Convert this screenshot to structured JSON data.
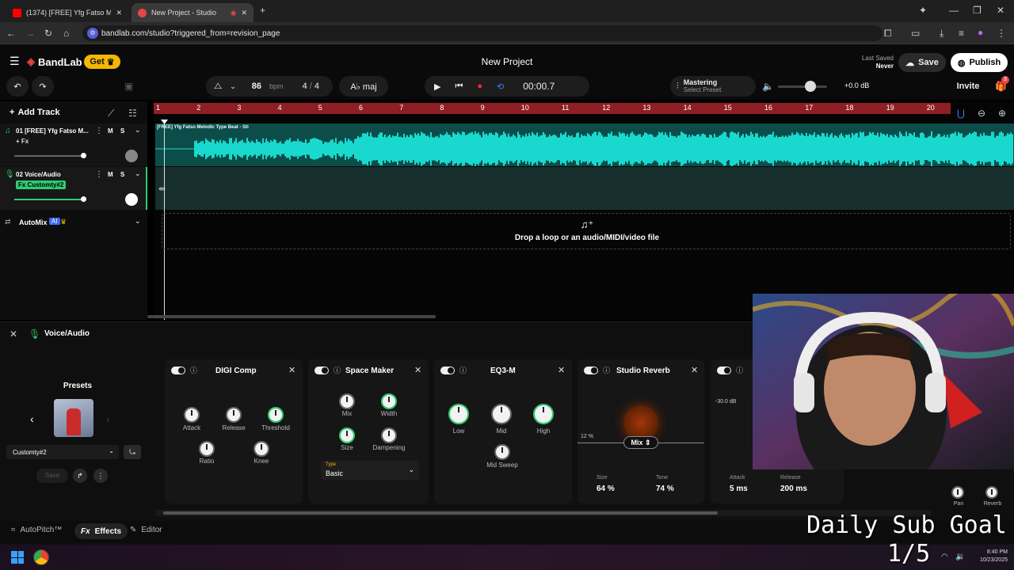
{
  "browser": {
    "tabs": [
      {
        "label": "(1374) [FREE] Yfg Fatso Melodic",
        "favicon_color": "#ff0000"
      },
      {
        "label": "New Project - Studio",
        "favicon_color": "#e84545"
      }
    ],
    "url": "bandlab.com/studio?triggered_from=revision_page"
  },
  "header": {
    "brand": "BandLab",
    "get_label": "Get",
    "project_title": "New Project",
    "last_saved_label": "Last Saved",
    "last_saved_value": "Never",
    "save_label": "Save",
    "publish_label": "Publish",
    "invite_label": "Invite",
    "gift_badge": "3"
  },
  "transport": {
    "bpm": "86",
    "bpm_unit": "bpm",
    "time_sig_num": "4",
    "time_sig_sep": "/",
    "time_sig_den": "4",
    "key": "A♭ maj",
    "time": "00:00.7",
    "mastering_label": "Mastering",
    "mastering_preset": "Select Preset",
    "volume_db": "+0.0 dB"
  },
  "tracks_panel": {
    "add_track_label": "Add Track",
    "tracks": [
      {
        "name": "01  [FREE] Yfg Fatso M...",
        "tag": "+ Fx",
        "mute": "M",
        "solo": "S"
      },
      {
        "name": "02  Voice/Audio",
        "tag": "Fx  Customty#2",
        "mute": "M",
        "solo": "S"
      }
    ],
    "automix_label": "AutoMix",
    "ai_badge": "AI"
  },
  "timeline": {
    "ruler": [
      "1",
      "2",
      "3",
      "4",
      "5",
      "6",
      "7",
      "8",
      "9",
      "10",
      "11",
      "12",
      "13",
      "14",
      "15",
      "16",
      "17",
      "18",
      "19",
      "20"
    ],
    "clip_label": "[FREE] Yfg Fatso Melodic Type Beat - Sti",
    "drop_text": "Drop a loop or an audio/MIDI/video file"
  },
  "fx": {
    "track_label": "Voice/Audio",
    "presets_title": "Presets",
    "preset_name": "Customty#2",
    "save_label": "Save",
    "digi_comp": {
      "title": "DIGI Comp",
      "knobs": [
        "Attack",
        "Release",
        "Threshold",
        "Ratio",
        "Knee"
      ]
    },
    "space_maker": {
      "title": "Space Maker",
      "knobs": [
        "Mix",
        "Width",
        "Size",
        "Dampening"
      ],
      "type_label": "Type",
      "type_value": "Basic"
    },
    "eq": {
      "title": "EQ3-M",
      "knobs": [
        "Low",
        "Mid",
        "High",
        "Mid Sweep"
      ]
    },
    "reverb": {
      "title": "Studio Reverb",
      "left_pct": "12 %",
      "mix_label": "Mix",
      "size_label": "Size",
      "size_value": "64 %",
      "tone_label": "Tone",
      "tone_value": "74 %"
    },
    "fifth": {
      "db": "-30.0 dB",
      "attack_label": "Attack",
      "attack_value": "5 ms",
      "release_label": "Release",
      "release_value": "200 ms"
    },
    "pan_label": "Pan",
    "reverb_label": "Reverb"
  },
  "bottom_tabs": {
    "autopitch": "AutoPitch™",
    "effects": "Effects",
    "editor": "Editor"
  },
  "overlay": {
    "goal_line1": "Daily Sub Goal",
    "goal_line2": "1/5"
  },
  "taskbar": {
    "time": "8:40 PM",
    "date": "10/23/2025"
  },
  "colors": {
    "accent_red": "#e84545",
    "ruler_red": "#8e1f24",
    "wave_cyan": "#19d9cf",
    "green": "#2ecc71",
    "get_yellow": "#f5b700"
  }
}
